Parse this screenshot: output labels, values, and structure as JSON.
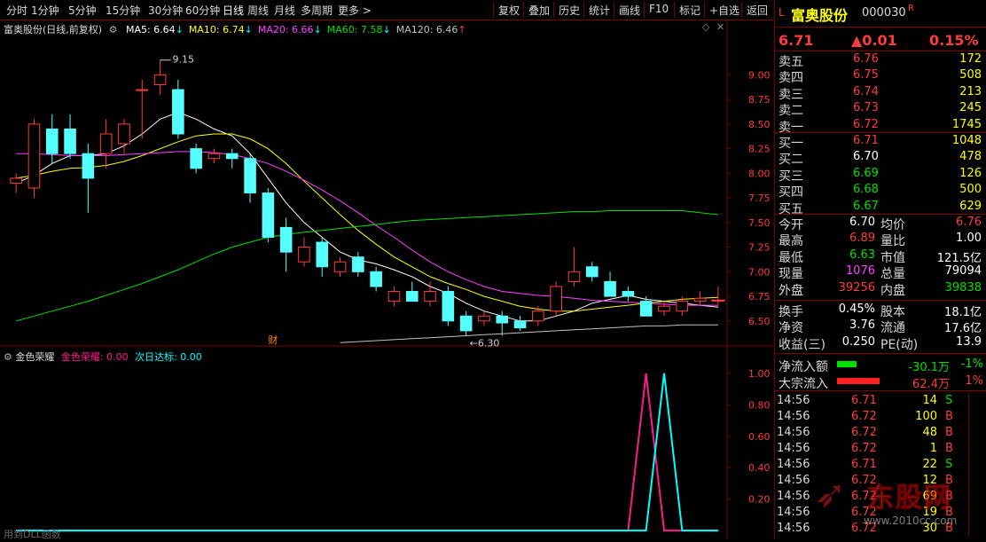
{
  "toolbar": {
    "periods": [
      "分时",
      "1分钟",
      "5分钟",
      "15分钟",
      "30分钟",
      "60分钟",
      "日线",
      "周线",
      "月线",
      "多周期",
      "更多 >"
    ],
    "active": "日线",
    "actions": [
      "复权",
      "叠加",
      "历史",
      "统计",
      "画线",
      "F10",
      "标记",
      "+自选",
      "返回"
    ]
  },
  "chart_header": {
    "title": "富奥股份(日线,前复权)",
    "ma": [
      {
        "label": "MA5: 6.64",
        "arrow": "↓",
        "color": "#ffffff"
      },
      {
        "label": "MA10: 6.74",
        "arrow": "↓",
        "color": "#ffff00"
      },
      {
        "label": "MA20: 6.66",
        "arrow": "↓",
        "color": "#ff40ff"
      },
      {
        "label": "MA60: 7.58",
        "arrow": "↓",
        "color": "#00e000"
      },
      {
        "label": "MA120: 6.46",
        "arrow": "↑",
        "color": "#c0c0c0"
      }
    ],
    "high_label": "9.15",
    "low_label": "6.30",
    "event_mark": "财"
  },
  "indicator": {
    "name": "金色荣耀",
    "line1": "金色荣耀: 0.00",
    "line2": "次日达标: 0.00",
    "footer": "用到DLL函数"
  },
  "chart_data": [
    {
      "type": "candlestick",
      "y_ticks": [
        9.0,
        8.75,
        8.5,
        8.25,
        8.0,
        7.75,
        7.5,
        7.25,
        7.0,
        6.75,
        6.5
      ],
      "ylim": [
        6.3,
        9.4
      ],
      "candles": [
        {
          "o": 7.9,
          "h": 8.0,
          "l": 7.8,
          "c": 7.95
        },
        {
          "o": 7.85,
          "h": 8.55,
          "l": 7.75,
          "c": 8.5
        },
        {
          "o": 8.45,
          "h": 8.6,
          "l": 8.1,
          "c": 8.2
        },
        {
          "o": 8.45,
          "h": 8.6,
          "l": 8.15,
          "c": 8.2
        },
        {
          "o": 8.2,
          "h": 8.3,
          "l": 7.6,
          "c": 7.95
        },
        {
          "o": 8.2,
          "h": 8.55,
          "l": 8.05,
          "c": 8.4
        },
        {
          "o": 8.3,
          "h": 8.55,
          "l": 8.2,
          "c": 8.5
        },
        {
          "o": 8.85,
          "h": 8.95,
          "l": 8.35,
          "c": 8.85
        },
        {
          "o": 8.9,
          "h": 9.15,
          "l": 8.8,
          "c": 9.0
        },
        {
          "o": 8.85,
          "h": 8.95,
          "l": 8.35,
          "c": 8.4
        },
        {
          "o": 8.25,
          "h": 8.3,
          "l": 8.0,
          "c": 8.05
        },
        {
          "o": 8.15,
          "h": 8.25,
          "l": 8.1,
          "c": 8.2
        },
        {
          "o": 8.2,
          "h": 8.25,
          "l": 8.05,
          "c": 8.15
        },
        {
          "o": 8.15,
          "h": 8.2,
          "l": 7.7,
          "c": 7.8
        },
        {
          "o": 7.8,
          "h": 7.85,
          "l": 7.3,
          "c": 7.35
        },
        {
          "o": 7.45,
          "h": 7.55,
          "l": 7.0,
          "c": 7.2
        },
        {
          "o": 7.1,
          "h": 7.35,
          "l": 7.05,
          "c": 7.25
        },
        {
          "o": 7.3,
          "h": 7.35,
          "l": 6.95,
          "c": 7.05
        },
        {
          "o": 7.0,
          "h": 7.15,
          "l": 6.95,
          "c": 7.1
        },
        {
          "o": 7.15,
          "h": 7.2,
          "l": 6.95,
          "c": 7.0
        },
        {
          "o": 7.0,
          "h": 7.05,
          "l": 6.8,
          "c": 6.85
        },
        {
          "o": 6.7,
          "h": 6.85,
          "l": 6.65,
          "c": 6.8
        },
        {
          "o": 6.8,
          "h": 6.9,
          "l": 6.7,
          "c": 6.7
        },
        {
          "o": 6.7,
          "h": 6.9,
          "l": 6.65,
          "c": 6.8
        },
        {
          "o": 6.8,
          "h": 6.85,
          "l": 6.45,
          "c": 6.5
        },
        {
          "o": 6.55,
          "h": 6.6,
          "l": 6.35,
          "c": 6.4
        },
        {
          "o": 6.5,
          "h": 6.6,
          "l": 6.45,
          "c": 6.55
        },
        {
          "o": 6.55,
          "h": 6.6,
          "l": 6.35,
          "c": 6.48
        },
        {
          "o": 6.5,
          "h": 6.55,
          "l": 6.4,
          "c": 6.43
        },
        {
          "o": 6.5,
          "h": 6.65,
          "l": 6.45,
          "c": 6.6
        },
        {
          "o": 6.6,
          "h": 6.9,
          "l": 6.55,
          "c": 6.85
        },
        {
          "o": 6.9,
          "h": 7.25,
          "l": 6.85,
          "c": 7.0
        },
        {
          "o": 7.05,
          "h": 7.1,
          "l": 6.9,
          "c": 6.95
        },
        {
          "o": 6.9,
          "h": 7.0,
          "l": 6.75,
          "c": 6.75
        },
        {
          "o": 6.8,
          "h": 6.85,
          "l": 6.7,
          "c": 6.75
        },
        {
          "o": 6.7,
          "h": 6.75,
          "l": 6.55,
          "c": 6.55
        },
        {
          "o": 6.6,
          "h": 6.7,
          "l": 6.55,
          "c": 6.65
        },
        {
          "o": 6.6,
          "h": 6.75,
          "l": 6.55,
          "c": 6.7
        },
        {
          "o": 6.7,
          "h": 6.8,
          "l": 6.65,
          "c": 6.73
        },
        {
          "o": 6.7,
          "h": 6.85,
          "l": 6.65,
          "c": 6.71
        }
      ],
      "ma_series": [
        {
          "name": "MA5",
          "color": "#ffffff",
          "values": [
            7.9,
            7.98,
            8.1,
            8.18,
            8.18,
            8.2,
            8.28,
            8.4,
            8.55,
            8.62,
            8.55,
            8.45,
            8.38,
            8.2,
            7.95,
            7.7,
            7.5,
            7.35,
            7.2,
            7.12,
            7.08,
            7.02,
            6.95,
            6.85,
            6.78,
            6.68,
            6.6,
            6.55,
            6.5,
            6.5,
            6.55,
            6.6,
            6.68,
            6.72,
            6.76,
            6.72,
            6.7,
            6.68,
            6.66,
            6.64
          ]
        },
        {
          "name": "MA10",
          "color": "#ffff00",
          "values": [
            7.95,
            7.98,
            8.02,
            8.05,
            8.06,
            8.08,
            8.12,
            8.18,
            8.25,
            8.32,
            8.38,
            8.4,
            8.4,
            8.35,
            8.25,
            8.1,
            7.92,
            7.75,
            7.58,
            7.42,
            7.28,
            7.15,
            7.05,
            6.95,
            6.88,
            6.82,
            6.75,
            6.7,
            6.65,
            6.62,
            6.6,
            6.6,
            6.62,
            6.64,
            6.66,
            6.68,
            6.7,
            6.72,
            6.73,
            6.74
          ]
        },
        {
          "name": "MA20",
          "color": "#ff40ff",
          "values": [
            8.2,
            8.2,
            8.19,
            8.18,
            8.18,
            8.18,
            8.19,
            8.2,
            8.21,
            8.22,
            8.22,
            8.21,
            8.19,
            8.15,
            8.1,
            8.02,
            7.93,
            7.83,
            7.72,
            7.6,
            7.47,
            7.35,
            7.22,
            7.1,
            7.0,
            6.92,
            6.85,
            6.8,
            6.78,
            6.76,
            6.75,
            6.73,
            6.71,
            6.7,
            6.69,
            6.68,
            6.67,
            6.66,
            6.66,
            6.66
          ]
        },
        {
          "name": "MA60",
          "color": "#00e000",
          "values": [
            6.5,
            6.55,
            6.6,
            6.65,
            6.7,
            6.76,
            6.82,
            6.88,
            6.95,
            7.02,
            7.1,
            7.18,
            7.25,
            7.3,
            7.35,
            7.38,
            7.4,
            7.42,
            7.44,
            7.46,
            7.48,
            7.5,
            7.52,
            7.53,
            7.54,
            7.55,
            7.56,
            7.57,
            7.58,
            7.59,
            7.6,
            7.61,
            7.61,
            7.62,
            7.62,
            7.62,
            7.62,
            7.62,
            7.6,
            7.58
          ]
        },
        {
          "name": "MA120",
          "color": "#c0c0c0",
          "values": [
            null,
            null,
            null,
            null,
            null,
            null,
            null,
            null,
            null,
            null,
            null,
            null,
            null,
            null,
            null,
            null,
            null,
            null,
            6.28,
            6.29,
            6.3,
            6.31,
            6.32,
            6.33,
            6.34,
            6.35,
            6.36,
            6.37,
            6.38,
            6.39,
            6.4,
            6.41,
            6.42,
            6.43,
            6.44,
            6.45,
            6.45,
            6.46,
            6.46,
            6.46
          ]
        }
      ]
    },
    {
      "type": "line",
      "y_ticks": [
        1.0,
        0.8,
        0.6,
        0.4,
        0.2
      ],
      "ylim": [
        -0.05,
        1.05
      ],
      "series": [
        {
          "color": "#ff1a8c",
          "values": [
            0,
            0,
            0,
            0,
            0,
            0,
            0,
            0,
            0,
            0,
            0,
            0,
            0,
            0,
            0,
            0,
            0,
            0,
            0,
            0,
            0,
            0,
            0,
            0,
            0,
            0,
            0,
            0,
            0,
            0,
            0,
            0,
            0,
            0,
            0,
            1,
            0,
            0,
            0,
            0
          ]
        },
        {
          "color": "#00ffff",
          "values": [
            0,
            0,
            0,
            0,
            0,
            0,
            0,
            0,
            0,
            0,
            0,
            0,
            0,
            0,
            0,
            0,
            0,
            0,
            0,
            0,
            0,
            0,
            0,
            0,
            0,
            0,
            0,
            0,
            0,
            0,
            0,
            0,
            0,
            0,
            0,
            0,
            1,
            0,
            0,
            0
          ]
        }
      ]
    }
  ],
  "quote": {
    "market": "L",
    "name": "富奥股份",
    "code": "000030",
    "flag": "R",
    "price": "6.71",
    "change": "▲0.01",
    "change_pct": "0.15%",
    "asks": [
      {
        "label": "卖五",
        "price": "6.76",
        "vol": "172"
      },
      {
        "label": "卖四",
        "price": "6.75",
        "vol": "508"
      },
      {
        "label": "卖三",
        "price": "6.74",
        "vol": "213"
      },
      {
        "label": "卖二",
        "price": "6.73",
        "vol": "245"
      },
      {
        "label": "卖一",
        "price": "6.72",
        "vol": "1745"
      }
    ],
    "bids": [
      {
        "label": "买一",
        "price": "6.71",
        "vol": "1048",
        "color": "#ff3c3c"
      },
      {
        "label": "买二",
        "price": "6.70",
        "vol": "478",
        "color": "#ffffff"
      },
      {
        "label": "买三",
        "price": "6.69",
        "vol": "126",
        "color": "#00e000"
      },
      {
        "label": "买四",
        "price": "6.68",
        "vol": "500",
        "color": "#00e000"
      },
      {
        "label": "买五",
        "price": "6.67",
        "vol": "629",
        "color": "#00e000"
      }
    ],
    "stats": [
      {
        "l1": "今开",
        "v1": "6.70",
        "c1": "#ffffff",
        "l2": "均价",
        "v2": "6.76",
        "c2": "#ff3c3c"
      },
      {
        "l1": "最高",
        "v1": "6.89",
        "c1": "#ff3c3c",
        "l2": "量比",
        "v2": "1.00",
        "c2": "#ffffff"
      },
      {
        "l1": "最低",
        "v1": "6.63",
        "c1": "#00e000",
        "l2": "市值",
        "v2": "121.5亿",
        "c2": "#ffffff"
      },
      {
        "l1": "现量",
        "v1": "1076",
        "c1": "#ff40ff",
        "l2": "总量",
        "v2": "79094",
        "c2": "#ffffff"
      },
      {
        "l1": "外盘",
        "v1": "39256",
        "c1": "#ff3c3c",
        "l2": "内盘",
        "v2": "39838",
        "c2": "#00e000"
      }
    ],
    "fund": [
      {
        "l1": "换手",
        "v1": "0.45%",
        "l2": "股本",
        "v2": "18.1亿"
      },
      {
        "l1": "净资",
        "v1": "3.76",
        "l2": "流通",
        "v2": "17.6亿"
      },
      {
        "l1": "收益(三)",
        "v1": "0.250",
        "l2": "PE(动)",
        "v2": "13.9"
      }
    ],
    "flows": [
      {
        "label": "净流入额",
        "value": "-30.1万",
        "pct": "-1%",
        "bar_color": "#00e000",
        "text_color": "#00e000",
        "fill": 0.4
      },
      {
        "label": "大宗流入",
        "value": "62.4万",
        "pct": "1%",
        "bar_color": "#ff2020",
        "text_color": "#ff3c3c",
        "fill": 0.85
      }
    ],
    "ticks": [
      {
        "time": "14:56",
        "price": "6.71",
        "pc": "#ff3c3c",
        "vol": "14",
        "side": "S",
        "sc": "#00e000"
      },
      {
        "time": "14:56",
        "price": "6.72",
        "pc": "#ff3c3c",
        "vol": "100",
        "side": "B",
        "sc": "#ff3c3c"
      },
      {
        "time": "14:56",
        "price": "6.72",
        "pc": "#ff3c3c",
        "vol": "48",
        "side": "B",
        "sc": "#ff3c3c"
      },
      {
        "time": "14:56",
        "price": "6.72",
        "pc": "#ff3c3c",
        "vol": "1",
        "side": "B",
        "sc": "#ff3c3c"
      },
      {
        "time": "14:56",
        "price": "6.71",
        "pc": "#ff3c3c",
        "vol": "22",
        "side": "S",
        "sc": "#00e000"
      },
      {
        "time": "14:56",
        "price": "6.72",
        "pc": "#ff3c3c",
        "vol": "12",
        "side": "B",
        "sc": "#ff3c3c"
      },
      {
        "time": "14:56",
        "price": "6.72",
        "pc": "#ff3c3c",
        "vol": "69",
        "side": "B",
        "sc": "#ff3c3c"
      },
      {
        "time": "14:56",
        "price": "6.72",
        "pc": "#ff3c3c",
        "vol": "19",
        "side": "B",
        "sc": "#ff3c3c"
      },
      {
        "time": "14:56",
        "price": "6.72",
        "pc": "#ff3c3c",
        "vol": "30",
        "side": "B",
        "sc": "#ff3c3c"
      }
    ],
    "watermark": {
      "brand": "东股网",
      "url": "www.2010cc.com"
    }
  }
}
